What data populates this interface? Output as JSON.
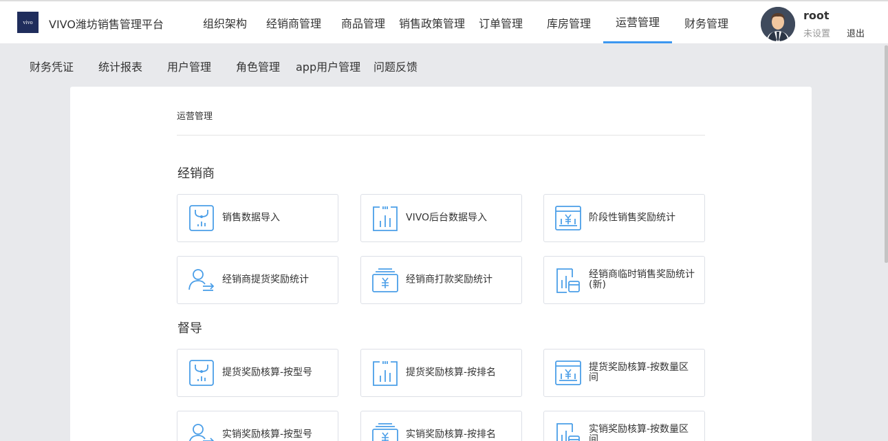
{
  "header": {
    "logo_text": "vivo",
    "app_title": "VIVO潍坊销售管理平台",
    "nav": [
      "组织架构",
      "经销商管理",
      "商品管理",
      "销售政策管理",
      "订单管理",
      "库房管理",
      "运营管理",
      "财务管理"
    ],
    "active_nav": "运营管理",
    "username": "root",
    "user_setting": "未设置",
    "logout": "退出"
  },
  "subnav": [
    "财务凭证",
    "统计报表",
    "用户管理",
    "角色管理",
    "app用户管理",
    "问题反馈"
  ],
  "panel": {
    "title": "运营管理",
    "sections": [
      {
        "title": "经销商",
        "cards": [
          {
            "label": "销售数据导入",
            "icon": "sales-import-icon"
          },
          {
            "label": "VIVO后台数据导入",
            "icon": "bar-chart-icon"
          },
          {
            "label": "阶段性销售奖励统计",
            "icon": "yen-screen-icon"
          },
          {
            "label": "经销商提货奖励统计",
            "icon": "user-transfer-icon"
          },
          {
            "label": "经销商打款奖励统计",
            "icon": "yen-wallet-icon"
          },
          {
            "label": "经销商临时销售奖励统计(新)",
            "icon": "chart-card-icon"
          }
        ]
      },
      {
        "title": "督导",
        "cards": [
          {
            "label": "提货奖励核算-按型号",
            "icon": "sales-import-icon"
          },
          {
            "label": "提货奖励核算-按排名",
            "icon": "bar-chart-icon"
          },
          {
            "label": "提货奖励核算-按数量区间",
            "icon": "yen-screen-icon"
          },
          {
            "label": "实销奖励核算-按型号",
            "icon": "user-transfer-icon"
          },
          {
            "label": "实销奖励核算-按排名",
            "icon": "yen-wallet-icon"
          },
          {
            "label": "实销奖励核算-按数量区间",
            "icon": "chart-card-icon"
          }
        ]
      }
    ]
  },
  "colors": {
    "accent": "#3b97f0",
    "icon": "#4a9ee8",
    "border": "#dcdfe6"
  }
}
